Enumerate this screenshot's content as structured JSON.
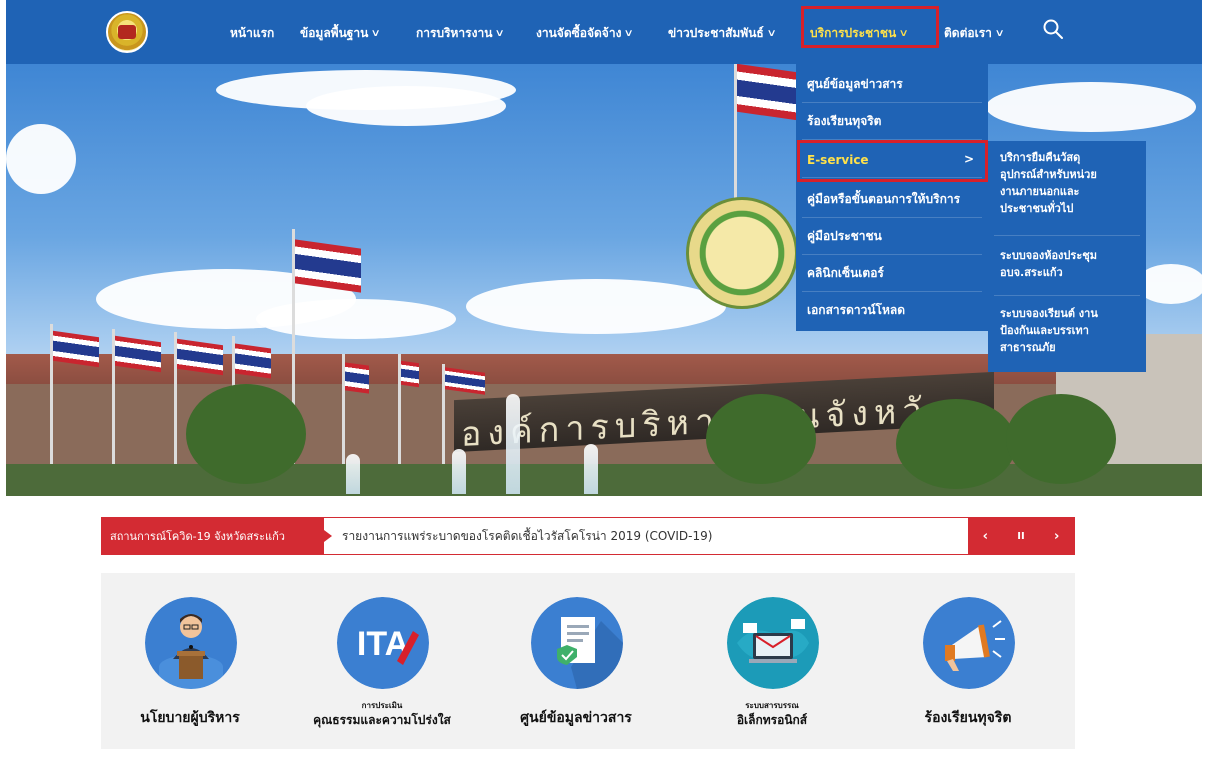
{
  "nav": {
    "items": [
      {
        "label": "หน้าแรก",
        "has_dropdown": false
      },
      {
        "label": "ข้อมูลพื้นฐาน",
        "has_dropdown": true
      },
      {
        "label": "การบริหารงาน",
        "has_dropdown": true
      },
      {
        "label": "งานจัดซื้อจัดจ้าง",
        "has_dropdown": true
      },
      {
        "label": "ข่าวประชาสัมพันธ์",
        "has_dropdown": true
      },
      {
        "label": "บริการประชาชน",
        "has_dropdown": true,
        "active": true
      },
      {
        "label": "ติดต่อเรา",
        "has_dropdown": true
      }
    ],
    "chevron": "∨"
  },
  "hero": {
    "sign_text": "องค์การบริหารส่วนจังหวัด"
  },
  "dropdown": {
    "items": [
      {
        "label": "ศูนย์ข้อมูลข่าวสาร"
      },
      {
        "label": "ร้องเรียนทุจริต"
      },
      {
        "label": "E-service",
        "active": true,
        "arrow": ">"
      },
      {
        "label": "คู่มือหรือขั้นตอนการให้บริการ"
      },
      {
        "label": "คู่มือประชาชน"
      },
      {
        "label": "คลินิกเซ็นเตอร์"
      },
      {
        "label": "เอกสารดาวน์โหลด"
      }
    ]
  },
  "submenu": {
    "items": [
      {
        "lines": [
          "บริการยืมคืนวัสดุ",
          "อุปกรณ์สำหรับหน่วย",
          "งานภายนอกและ",
          "ประชาชนทั่วไป"
        ]
      },
      {
        "lines": [
          "ระบบจองห้องประชุม",
          "อบจ.สระแก้ว"
        ]
      },
      {
        "lines": [
          "ระบบจองเรียนต์ งาน",
          "ป้องกันและบรรเทา",
          "สาธารณภัย"
        ]
      }
    ]
  },
  "ticker": {
    "label": "สถานการณ์โควิด-19 จังหวัดสระแก้ว",
    "text": "รายงานการแพร่ระบาดของโรคติดเชื้อไวรัสโคโรน่า 2019 (COVID-19)",
    "prev": "‹",
    "pause": "II",
    "next": "›"
  },
  "services": [
    {
      "label": "นโยบายผู้บริหาร",
      "icon": "executive-icon"
    },
    {
      "label_small": "การประเมิน",
      "label": "คุณธรรมและความโปร่งใส",
      "icon": "ita-icon",
      "badge": "ITA"
    },
    {
      "label": "ศูนย์ข้อมูลข่าวสาร",
      "icon": "document-icon"
    },
    {
      "label_small": "ระบบสารบรรณ",
      "label": "อิเล็กทรอนิกส์",
      "icon": "e-document-icon"
    },
    {
      "label": "ร้องเรียนทุจริต",
      "icon": "megaphone-icon"
    }
  ],
  "colors": {
    "nav_bg": "#1f63b5",
    "active_text": "#ffe14a",
    "highlight_border": "#d8202a",
    "ticker_red": "#d32b33"
  }
}
